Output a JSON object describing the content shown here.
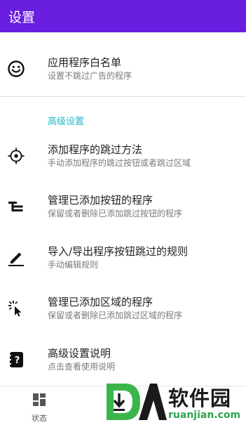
{
  "appbar": {
    "title": "设置"
  },
  "items": [
    {
      "icon": "smiley-icon",
      "title": "应用程序白名单",
      "summary": "设置不跳过广告的程序"
    },
    {
      "icon": "crosshair-icon",
      "title": "添加程序的跳过方法",
      "summary": "手动添加程序的跳过按钮或者跳过区域"
    },
    {
      "icon": "list-tree-icon",
      "title": "管理已添加按钮的程序",
      "summary": "保留或者删除已添加跳过按钮的程序"
    },
    {
      "icon": "pencil-icon",
      "title": "导入/导出程序按钮跳过的规则",
      "summary": "手动编辑规则"
    },
    {
      "icon": "cursor-click-icon",
      "title": "管理已添加区域的程序",
      "summary": "保留或者删除已添加跳过区域的程序"
    },
    {
      "icon": "help-notebook-icon",
      "title": "高级设置说明",
      "summary": "点击查看使用说明"
    }
  ],
  "category": {
    "label": "高级设置"
  },
  "bottom_nav": {
    "status_label": "状态"
  },
  "watermark": {
    "brand": "软件园",
    "domain": "ruanjian.com"
  },
  "colors": {
    "appbar": "#6a1ee0",
    "accent": "#21b7c9"
  }
}
